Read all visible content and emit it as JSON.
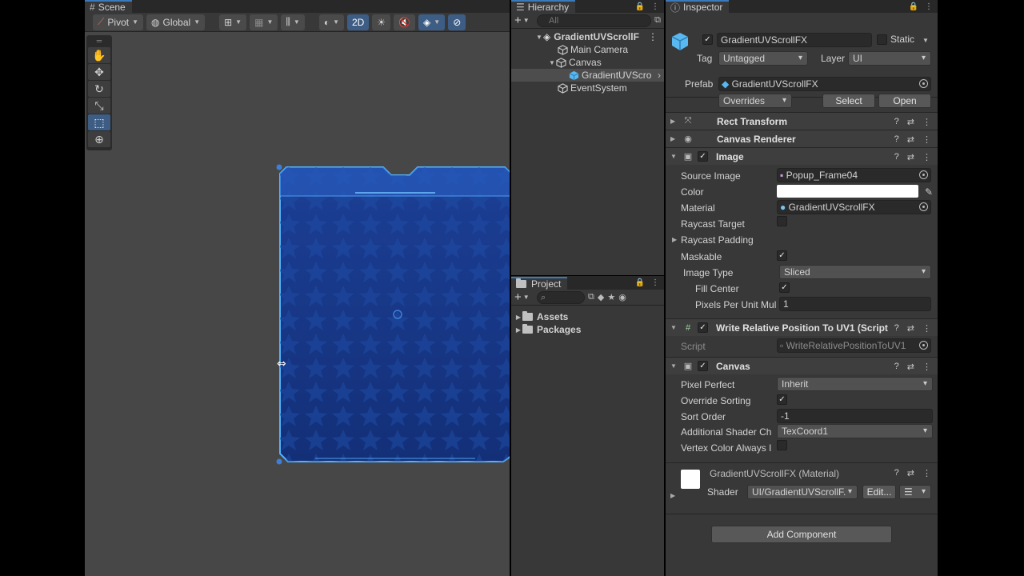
{
  "scene": {
    "tab_label": "Scene",
    "toolbar": {
      "pivot": "Pivot",
      "global": "Global",
      "mode_2d": "2D"
    }
  },
  "hierarchy": {
    "tab_label": "Hierarchy",
    "search_placeholder": "All",
    "items": [
      {
        "label": "GradientUVScrollF",
        "depth": 0
      },
      {
        "label": "Main Camera",
        "depth": 1
      },
      {
        "label": "Canvas",
        "depth": 1
      },
      {
        "label": "GradientUVScro",
        "depth": 2
      },
      {
        "label": "EventSystem",
        "depth": 1
      }
    ]
  },
  "project": {
    "tab_label": "Project",
    "folders": [
      "Assets",
      "Packages"
    ]
  },
  "inspector": {
    "tab_label": "Inspector",
    "object_name": "GradientUVScrollFX",
    "static_label": "Static",
    "tag_label": "Tag",
    "tag_value": "Untagged",
    "layer_label": "Layer",
    "layer_value": "UI",
    "prefab_label": "Prefab",
    "prefab_value": "GradientUVScrollFX",
    "overrides_label": "Overrides",
    "select_label": "Select",
    "open_label": "Open",
    "components": {
      "rect_transform": "Rect Transform",
      "canvas_renderer": "Canvas Renderer",
      "image": {
        "title": "Image",
        "source_image_label": "Source Image",
        "source_image_value": "Popup_Frame04",
        "color_label": "Color",
        "color_value": "#ffffff",
        "material_label": "Material",
        "material_value": "GradientUVScrollFX",
        "raycast_target_label": "Raycast Target",
        "raycast_padding_label": "Raycast Padding",
        "maskable_label": "Maskable",
        "image_type_label": "Image Type",
        "image_type_value": "Sliced",
        "fill_center_label": "Fill Center",
        "ppu_label": "Pixels Per Unit Mul",
        "ppu_value": "1"
      },
      "write_relative": {
        "title": "Write Relative Position To UV1 (Script",
        "script_label": "Script",
        "script_value": "WriteRelativePositionToUV1"
      },
      "canvas": {
        "title": "Canvas",
        "pixel_perfect_label": "Pixel Perfect",
        "pixel_perfect_value": "Inherit",
        "override_sorting_label": "Override Sorting",
        "sort_order_label": "Sort Order",
        "sort_order_value": "-1",
        "additional_shader_label": "Additional Shader Ch",
        "additional_shader_value": "TexCoord1",
        "vertex_color_label": "Vertex Color Always I"
      },
      "material": {
        "title": "GradientUVScrollFX (Material)",
        "shader_label": "Shader",
        "shader_value": "UI/GradientUVScrollF.",
        "edit_label": "Edit..."
      }
    },
    "add_component_label": "Add Component"
  },
  "colors": {
    "accent": "#3d5d84",
    "frame_blue": "#1a3d8c",
    "frame_edge": "#4aa6ff"
  }
}
